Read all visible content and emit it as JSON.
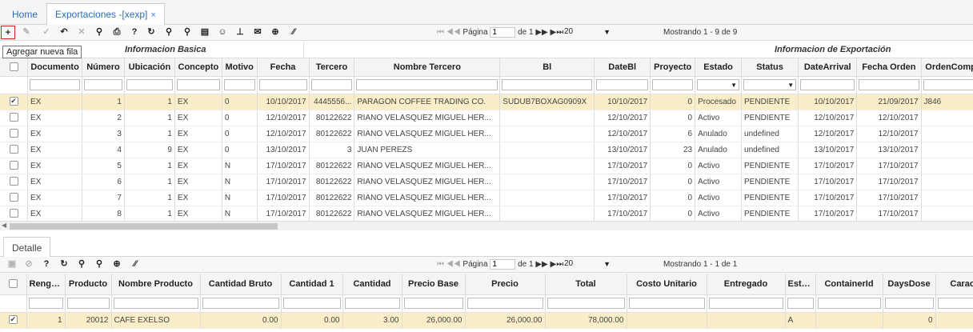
{
  "tabs": {
    "home": "Home",
    "active": "Exportaciones -[xexp]",
    "close": "×"
  },
  "toolbar": {
    "icons": [
      "add-icon",
      "edit-icon",
      "check-icon",
      "undo-icon",
      "delete-icon",
      "search-icon",
      "print-icon",
      "help-icon",
      "refresh-icon",
      "zoom-icon",
      "search-alt-icon",
      "comment-icon",
      "user-icon",
      "pin-icon",
      "mail-icon",
      "plus-circle-icon",
      "resize-icon"
    ],
    "pager": {
      "first": "⏮",
      "prev": "◀◀",
      "page_label": "Página",
      "page_value": "1",
      "of_label": "de 1",
      "next": "▶▶",
      "last": "▶⏭",
      "page_size": "20",
      "showing": "Mostrando 1 - 9 de 9"
    }
  },
  "tooltip": "Agregar nueva fila",
  "groups": {
    "basic": "Informacion Basica",
    "export": "Informacion de Exportación"
  },
  "main_grid": {
    "columns": [
      "",
      "Documento",
      "Número",
      "Ubicación",
      "Concepto",
      "Motivo",
      "Fecha",
      "Tercero",
      "Nombre Tercero",
      "Bl",
      "DateBl",
      "Proyecto",
      "Estado",
      "Status",
      "DateArrival",
      "Fecha Orden",
      "OrdenCompra"
    ],
    "rows": [
      {
        "checked": true,
        "doc": "EX",
        "num": "1",
        "ubi": "1",
        "con": "EX",
        "mot": "0",
        "fecha": "10/10/2017",
        "ter": "4445556...",
        "nom": "PARAGON COFFEE TRADING CO.",
        "bl": "SUDUB7BOXAG0909X",
        "datebl": "10/10/2017",
        "proy": "0",
        "estado": "Procesado",
        "status": "PENDIENTE",
        "arr": "10/10/2017",
        "ford": "21/09/2017",
        "oc": "J846"
      },
      {
        "checked": false,
        "doc": "EX",
        "num": "2",
        "ubi": "1",
        "con": "EX",
        "mot": "0",
        "fecha": "12/10/2017",
        "ter": "80122622",
        "nom": "RIANO VELASQUEZ MIGUEL HER...",
        "bl": "",
        "datebl": "12/10/2017",
        "proy": "0",
        "estado": "Activo",
        "status": "PENDIENTE",
        "arr": "12/10/2017",
        "ford": "12/10/2017",
        "oc": ""
      },
      {
        "checked": false,
        "doc": "EX",
        "num": "3",
        "ubi": "1",
        "con": "EX",
        "mot": "0",
        "fecha": "12/10/2017",
        "ter": "80122622",
        "nom": "RIANO VELASQUEZ MIGUEL HER...",
        "bl": "",
        "datebl": "12/10/2017",
        "proy": "6",
        "estado": "Anulado",
        "status": "undefined",
        "arr": "12/10/2017",
        "ford": "12/10/2017",
        "oc": ""
      },
      {
        "checked": false,
        "doc": "EX",
        "num": "4",
        "ubi": "9",
        "con": "EX",
        "mot": "0",
        "fecha": "13/10/2017",
        "ter": "3",
        "nom": "JUAN PEREZS",
        "bl": "",
        "datebl": "13/10/2017",
        "proy": "23",
        "estado": "Anulado",
        "status": "undefined",
        "arr": "13/10/2017",
        "ford": "13/10/2017",
        "oc": ""
      },
      {
        "checked": false,
        "doc": "EX",
        "num": "5",
        "ubi": "1",
        "con": "EX",
        "mot": "N",
        "fecha": "17/10/2017",
        "ter": "80122622",
        "nom": "RIANO VELASQUEZ MIGUEL HER...",
        "bl": "",
        "datebl": "17/10/2017",
        "proy": "0",
        "estado": "Activo",
        "status": "PENDIENTE",
        "arr": "17/10/2017",
        "ford": "17/10/2017",
        "oc": ""
      },
      {
        "checked": false,
        "doc": "EX",
        "num": "6",
        "ubi": "1",
        "con": "EX",
        "mot": "N",
        "fecha": "17/10/2017",
        "ter": "80122622",
        "nom": "RIANO VELASQUEZ MIGUEL HER...",
        "bl": "",
        "datebl": "17/10/2017",
        "proy": "0",
        "estado": "Activo",
        "status": "PENDIENTE",
        "arr": "17/10/2017",
        "ford": "17/10/2017",
        "oc": ""
      },
      {
        "checked": false,
        "doc": "EX",
        "num": "7",
        "ubi": "1",
        "con": "EX",
        "mot": "N",
        "fecha": "17/10/2017",
        "ter": "80122622",
        "nom": "RIANO VELASQUEZ MIGUEL HER...",
        "bl": "",
        "datebl": "17/10/2017",
        "proy": "0",
        "estado": "Activo",
        "status": "PENDIENTE",
        "arr": "17/10/2017",
        "ford": "17/10/2017",
        "oc": ""
      },
      {
        "checked": false,
        "doc": "EX",
        "num": "8",
        "ubi": "1",
        "con": "EX",
        "mot": "N",
        "fecha": "17/10/2017",
        "ter": "80122622",
        "nom": "RIANO VELASQUEZ MIGUEL HER...",
        "bl": "",
        "datebl": "17/10/2017",
        "proy": "0",
        "estado": "Activo",
        "status": "PENDIENTE",
        "arr": "17/10/2017",
        "ford": "17/10/2017",
        "oc": ""
      }
    ]
  },
  "detail_tab": "Detalle",
  "detail_toolbar": {
    "icons": [
      "save-icon",
      "cancel-icon",
      "help-icon",
      "refresh-icon",
      "zoom-icon",
      "search-icon",
      "plus-circle-icon",
      "resize-icon"
    ],
    "pager": {
      "page_value": "1",
      "of_label": "de 1",
      "page_size": "20",
      "showing": "Mostrando 1 - 1 de 1"
    }
  },
  "detail_grid": {
    "columns": [
      "",
      "Renglón",
      "Producto",
      "Nombre Producto",
      "Cantidad Bruto",
      "Cantidad 1",
      "Cantidad",
      "Precio Base",
      "Precio",
      "Total",
      "Costo Unitario",
      "Entregado",
      "Estado",
      "ContainerId",
      "DaysDose",
      "Caract"
    ],
    "rows": [
      {
        "checked": true,
        "ren": "1",
        "prod": "20012",
        "nom": "CAFE EXELSO",
        "cb": "0.00",
        "c1": "0.00",
        "cant": "3.00",
        "pb": "26,000.00",
        "precio": "26,000.00",
        "total": "78,000.00",
        "cu": "",
        "ent": "",
        "estado": "A",
        "cont": "",
        "days": "0",
        "car": ""
      }
    ]
  }
}
